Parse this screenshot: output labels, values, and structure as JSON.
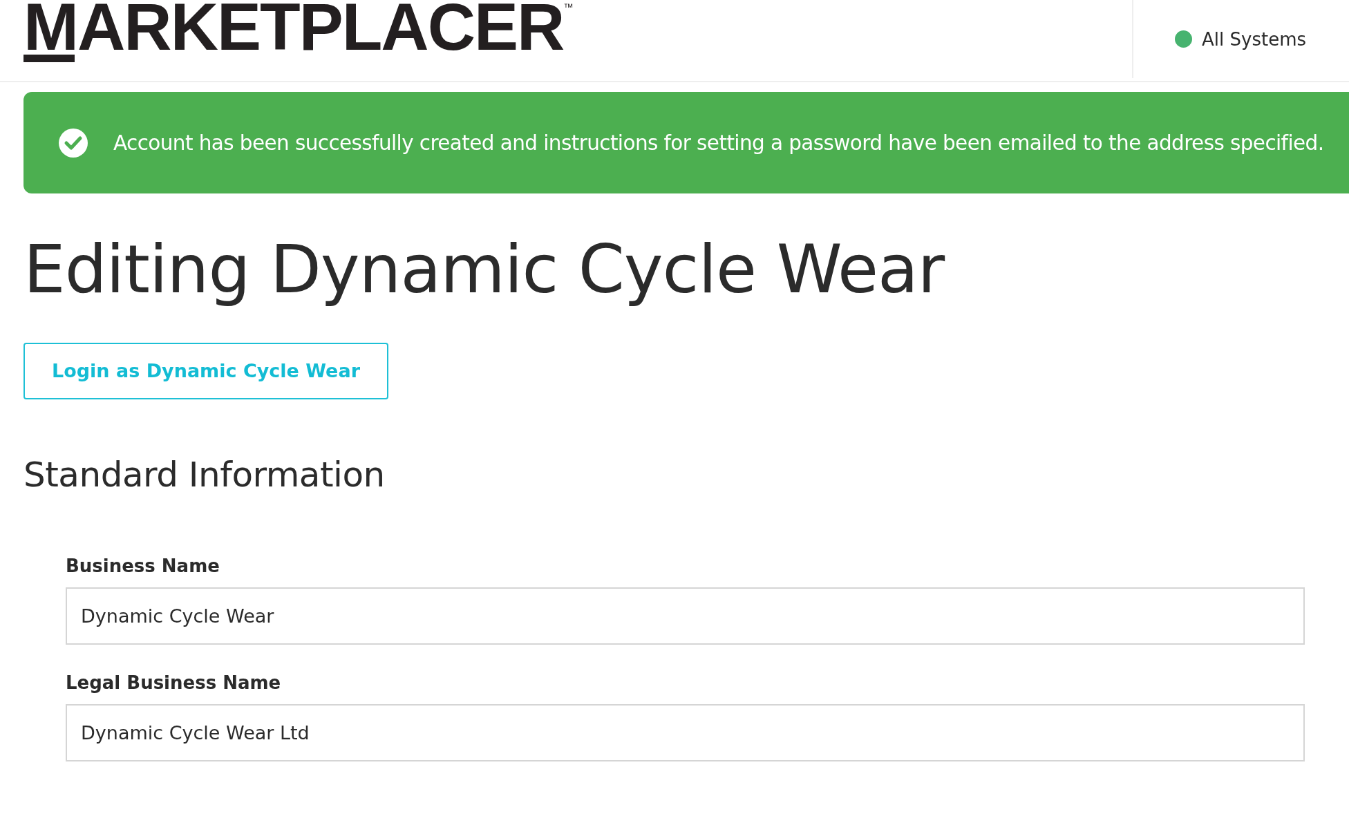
{
  "header": {
    "logo": "MARKETPLACER",
    "trademark": "™",
    "status": "All Systems"
  },
  "alert": {
    "kind": "success",
    "message": "Account has been successfully created and instructions for setting a password have been emailed to the address specified."
  },
  "title": "Editing Dynamic Cycle Wear",
  "login_button": "Login as Dynamic Cycle Wear",
  "section": {
    "title": "Standard Information",
    "fields": [
      {
        "label": "Business Name",
        "value": "Dynamic Cycle Wear"
      },
      {
        "label": "Legal Business Name",
        "value": "Dynamic Cycle Wear Ltd"
      }
    ]
  }
}
